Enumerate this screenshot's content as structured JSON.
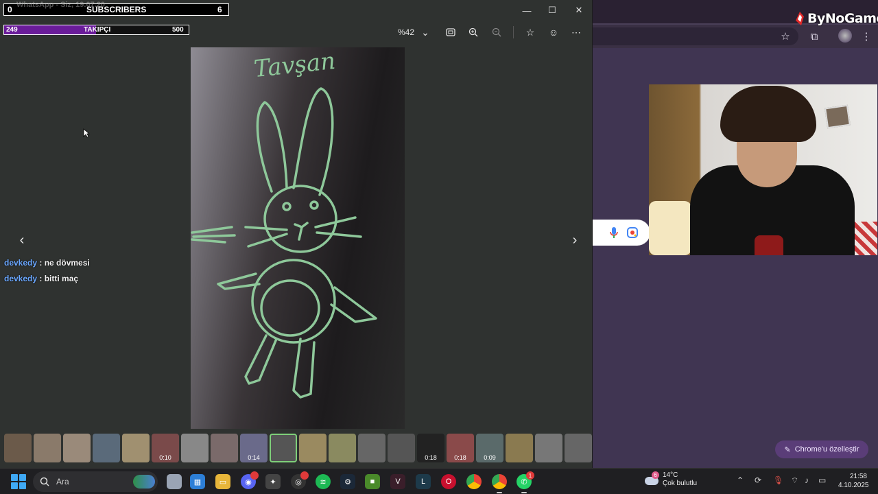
{
  "overlay": {
    "subscribers": {
      "label": "SUBSCRIBERS",
      "current": "0",
      "goal": "6"
    },
    "followers": {
      "label": "TAKIPÇI",
      "current": "249",
      "goal": "500",
      "progress": 0.498
    },
    "ghost_title": "WhatsApp - Siz, 19.07.20",
    "chat": [
      {
        "user": "devkedy",
        "text": " : ne dövmesi"
      },
      {
        "user": "devkedy",
        "text": " : bitti maç"
      }
    ]
  },
  "viewer": {
    "zoom": "%42",
    "photo_caption": "Tavşan",
    "thumbnails": [
      {
        "dur": ""
      },
      {
        "dur": ""
      },
      {
        "dur": ""
      },
      {
        "dur": ""
      },
      {
        "dur": ""
      },
      {
        "dur": "0:10"
      },
      {
        "dur": ""
      },
      {
        "dur": ""
      },
      {
        "dur": "0:14"
      },
      {
        "dur": "",
        "selected": true
      },
      {
        "dur": ""
      },
      {
        "dur": ""
      },
      {
        "dur": ""
      },
      {
        "dur": ""
      },
      {
        "dur": "0:18"
      },
      {
        "dur": "0:18"
      },
      {
        "dur": "0:09"
      },
      {
        "dur": ""
      },
      {
        "dur": ""
      },
      {
        "dur": ""
      }
    ]
  },
  "chrome": {
    "brand": "ByNoGame",
    "customize_label": "Chrome'u özelleştir"
  },
  "taskbar": {
    "search_placeholder": "Ara",
    "weather": {
      "temp": "14°C",
      "desc": "Çok bulutlu",
      "badge": "6"
    },
    "whatsapp_badge": "1",
    "time": "21:58",
    "date": "4.10.2025"
  },
  "colors": {
    "chat_user": "#6aa7ff",
    "follow_fill": "#6a1c9a",
    "drawing": "#8ec89a",
    "accent": "#7fd07a"
  }
}
